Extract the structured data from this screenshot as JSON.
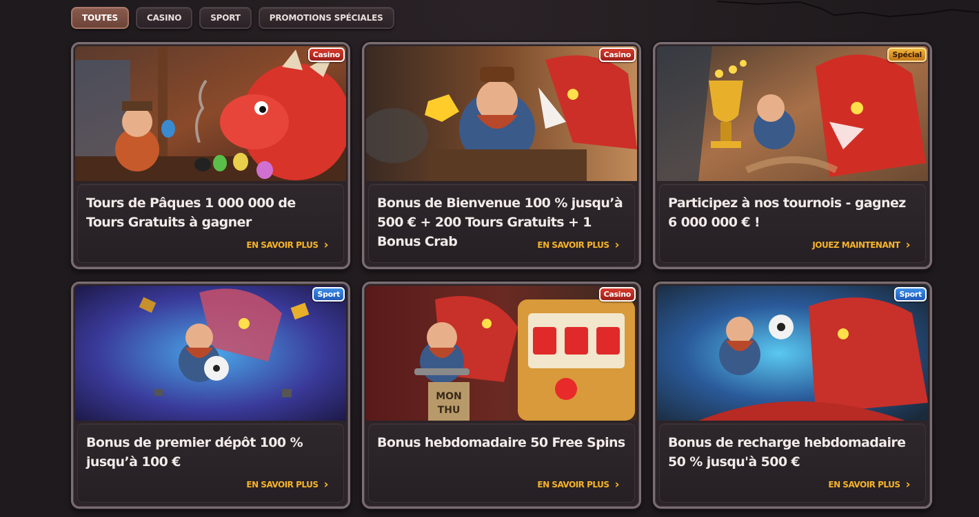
{
  "tabs": [
    {
      "label": "TOUTES",
      "active": true
    },
    {
      "label": "CASINO",
      "active": false
    },
    {
      "label": "SPORT",
      "active": false
    },
    {
      "label": "PROMOTIONS SPÉCIALES",
      "active": false
    }
  ],
  "cards": [
    {
      "badge": "Casino",
      "badge_type": "casino",
      "title": "Tours de Pâques 1 000 000 de Tours Gratuits à gagner",
      "cta": "EN SAVOIR PLUS",
      "icon": "chevron-right-icon"
    },
    {
      "badge": "Casino",
      "badge_type": "casino",
      "title": "Bonus de Bienvenue 100 % jusqu’à 500 € + 200 Tours Gratuits + 1 Bonus Crab",
      "cta": "EN SAVOIR PLUS",
      "icon": "chevron-right-icon"
    },
    {
      "badge": "Spécial",
      "badge_type": "special",
      "title": "Participez à nos tournois - gagnez 6 000 000 € !",
      "cta": "JOUEZ MAINTENANT",
      "icon": "chevron-right-icon"
    },
    {
      "badge": "Sport",
      "badge_type": "sport",
      "title": "Bonus de premier dépôt 100 % jusqu’à 100 €",
      "cta": "EN SAVOIR PLUS",
      "icon": "chevron-right-icon"
    },
    {
      "badge": "Casino",
      "badge_type": "casino",
      "title": "Bonus hebdomadaire 50 Free Spins",
      "cta": "EN SAVOIR PLUS",
      "icon": "chevron-right-icon"
    },
    {
      "badge": "Sport",
      "badge_type": "sport",
      "title": "Bonus de recharge hebdomadaire 50 % jusqu'à 500 €",
      "cta": "EN SAVOIR PLUS",
      "icon": "chevron-right-icon"
    }
  ],
  "slot_sign": {
    "line1": "MON",
    "line2": "THU"
  },
  "colors": {
    "accent": "#f6b32a",
    "background": "#1f1a1d",
    "casino_badge": "#d83a2c",
    "special_badge": "#f0b53a",
    "sport_badge": "#3c8ee8"
  }
}
